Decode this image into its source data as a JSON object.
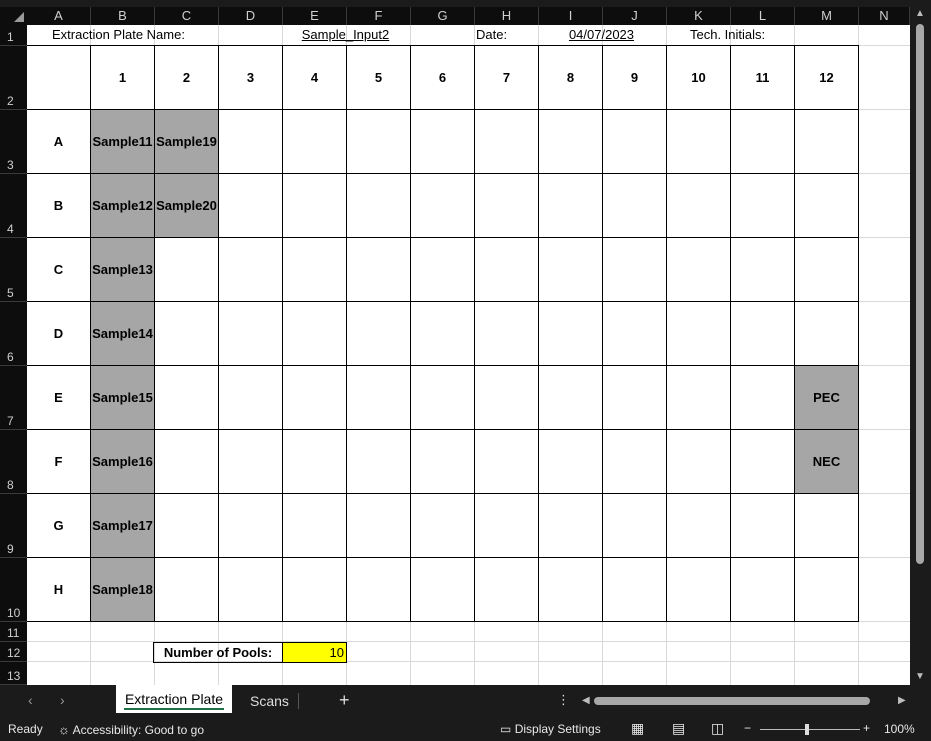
{
  "columns": [
    "A",
    "B",
    "C",
    "D",
    "E",
    "F",
    "G",
    "H",
    "I",
    "J",
    "K",
    "L",
    "M",
    "N"
  ],
  "rows": [
    "1",
    "2",
    "3",
    "4",
    "5",
    "6",
    "7",
    "8",
    "9",
    "10",
    "11",
    "12",
    "13"
  ],
  "header_row": {
    "plate_name_label": "Extraction Plate Name:",
    "plate_name_value": "Sample_Input2",
    "date_label": "Date:",
    "date_value": "04/07/2023",
    "initials_label": "Tech. Initials:"
  },
  "plate": {
    "column_numbers": [
      "1",
      "2",
      "3",
      "4",
      "5",
      "6",
      "7",
      "8",
      "9",
      "10",
      "11",
      "12"
    ],
    "row_letters": [
      "A",
      "B",
      "C",
      "D",
      "E",
      "F",
      "G",
      "H"
    ],
    "cells": [
      [
        "Sample11",
        "Sample19",
        "",
        "",
        "",
        "",
        "",
        "",
        "",
        "",
        "",
        ""
      ],
      [
        "Sample12",
        "Sample20",
        "",
        "",
        "",
        "",
        "",
        "",
        "",
        "",
        "",
        ""
      ],
      [
        "Sample13",
        "",
        "",
        "",
        "",
        "",
        "",
        "",
        "",
        "",
        "",
        ""
      ],
      [
        "Sample14",
        "",
        "",
        "",
        "",
        "",
        "",
        "",
        "",
        "",
        "",
        ""
      ],
      [
        "Sample15",
        "",
        "",
        "",
        "",
        "",
        "",
        "",
        "",
        "",
        "",
        "PEC"
      ],
      [
        "Sample16",
        "",
        "",
        "",
        "",
        "",
        "",
        "",
        "",
        "",
        "",
        "NEC"
      ],
      [
        "Sample17",
        "",
        "",
        "",
        "",
        "",
        "",
        "",
        "",
        "",
        "",
        ""
      ],
      [
        "Sample18",
        "",
        "",
        "",
        "",
        "",
        "",
        "",
        "",
        "",
        "",
        ""
      ]
    ]
  },
  "pools": {
    "label": "Number of Pools:",
    "value": "10"
  },
  "tabs": [
    {
      "label": "Extraction Plate",
      "active": true
    },
    {
      "label": "Scans",
      "active": false
    }
  ],
  "add_sheet_label": "+",
  "status_bar": {
    "ready": "Ready",
    "accessibility": "Accessibility: Good to go",
    "display_settings": "Display Settings",
    "zoom": "100%",
    "zoom_minus": "−",
    "zoom_plus": "+"
  },
  "colors": {
    "gray_fill": "#a6a6a6",
    "yellow_fill": "#ffff00",
    "chrome": "#1b1b1b"
  }
}
